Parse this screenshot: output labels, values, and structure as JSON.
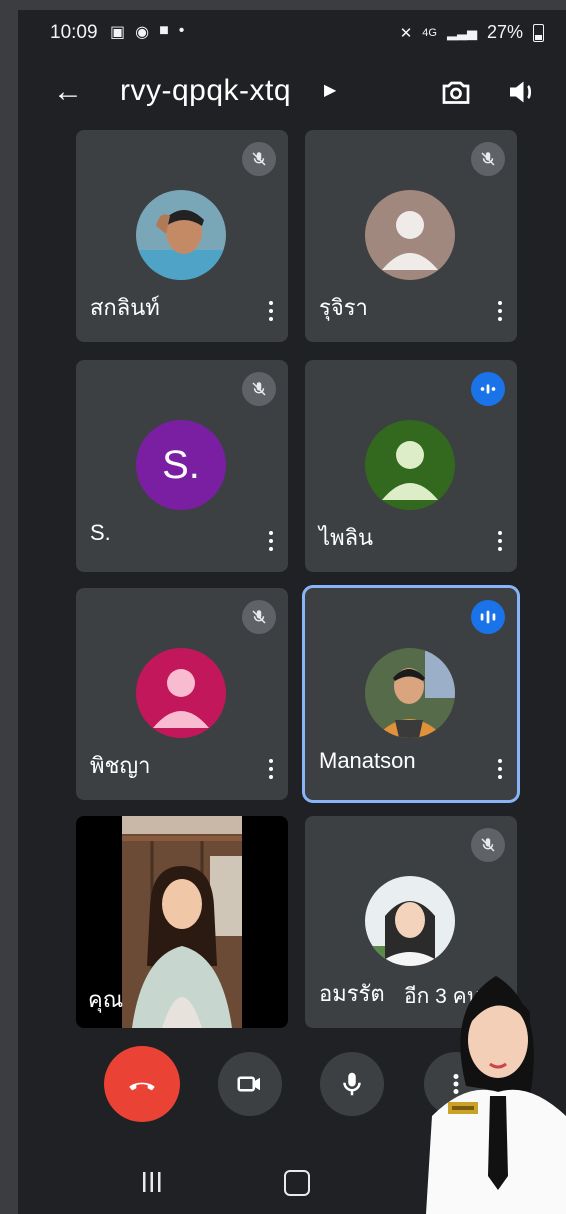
{
  "status_bar": {
    "time": "10:09",
    "network": "4G",
    "battery": "27%"
  },
  "header": {
    "meeting_code": "rvy-qpqk-xtq"
  },
  "participants": [
    {
      "name": "สกลินท์",
      "muted": true,
      "avatar": "photo"
    },
    {
      "name": "รุจิรา",
      "muted": true,
      "avatar": "default",
      "avatar_color": "#a1887f"
    },
    {
      "name": "S.",
      "muted": true,
      "avatar": "letter",
      "letter": "S.",
      "avatar_color": "#7b1fa2"
    },
    {
      "name": "ไพลิน",
      "muted": false,
      "speaking": true,
      "avatar": "default",
      "avatar_color": "#33691e"
    },
    {
      "name": "พิชญา",
      "muted": true,
      "avatar": "default",
      "avatar_color": "#c2185b"
    },
    {
      "name": "Manatson",
      "muted": false,
      "speaking": true,
      "active": true,
      "avatar": "photo"
    },
    {
      "name": "คุณ",
      "avatar": "video"
    },
    {
      "name": "อมรรัต",
      "muted": true,
      "avatar": "photo"
    }
  ],
  "more_participants": "อีก 3 คน",
  "colors": {
    "background": "#202124",
    "tile": "#3c4043",
    "end_call": "#ea4335",
    "active_border": "#8ab4f8",
    "speaking": "#1a73e8"
  }
}
